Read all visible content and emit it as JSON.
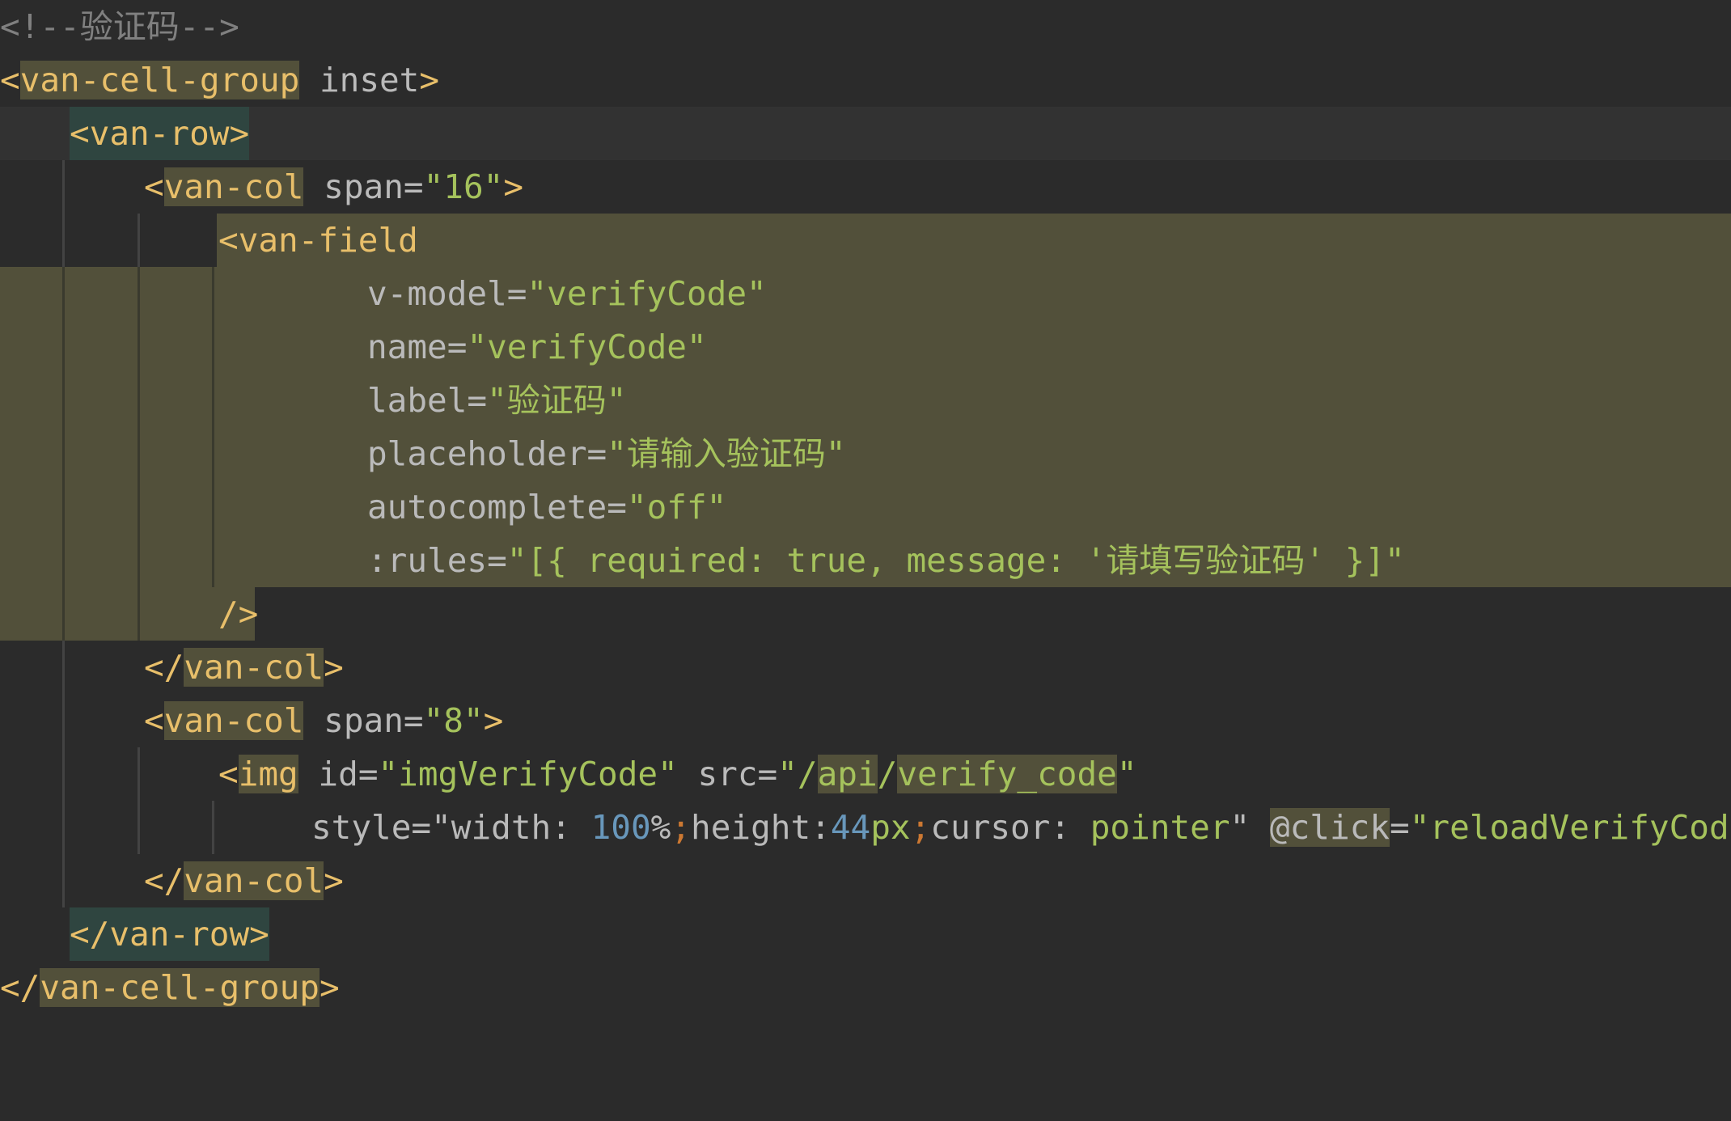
{
  "editor": {
    "theme": "darcula",
    "colors": {
      "background": "#2b2b2b",
      "current_line": "#323232",
      "selection": "#52503a",
      "tag": "#e8bf6a",
      "attr_name": "#bababa",
      "attr_value": "#a5c25c",
      "comment": "#808080",
      "number": "#6897bb",
      "punctuation": "#cc7832"
    },
    "lines": {
      "l1": {
        "comment": "<!--验证码-->"
      },
      "l2": {
        "open": "<",
        "tag": "van-cell-group",
        "attr": " inset",
        "close": ">"
      },
      "l3": {
        "open": "<",
        "tag": "van-row",
        "close": ">"
      },
      "l4": {
        "open": "<",
        "tag": "van-col",
        "attr_name": " span",
        "eq": "=",
        "attr_value": "\"16\"",
        "close": ">"
      },
      "l5": {
        "open": "<",
        "tag": "van-field"
      },
      "l6": {
        "attr_name": "v-model",
        "eq": "=",
        "attr_value": "\"verifyCode\""
      },
      "l7": {
        "attr_name": "name",
        "eq": "=",
        "attr_value": "\"verifyCode\""
      },
      "l8": {
        "attr_name": "label",
        "eq": "=",
        "attr_value": "\"验证码\""
      },
      "l9": {
        "attr_name": "placeholder",
        "eq": "=",
        "attr_value": "\"请输入验证码\""
      },
      "l10": {
        "attr_name": "autocomplete",
        "eq": "=",
        "attr_value": "\"off\""
      },
      "l11": {
        "attr_name": ":rules",
        "eq": "=",
        "attr_value": "\"[{ required: true, message: '请填写验证码' }]\""
      },
      "l12": {
        "close": "/>"
      },
      "l13": {
        "open": "</",
        "tag": "van-col",
        "close": ">"
      },
      "l14": {
        "open": "<",
        "tag": "van-col",
        "attr_name": " span",
        "eq": "=",
        "attr_value": "\"8\"",
        "close": ">"
      },
      "l15": {
        "open": "<",
        "tag": "img",
        "a1_name": " id",
        "eq": "=",
        "a1_value": "\"imgVerifyCode\"",
        "a2_name": " src",
        "a2_value_q1": "\"/",
        "a2_api": "api",
        "a2_slash": "/",
        "a2_path": "verify_code",
        "a2_value_q2": "\""
      },
      "l16": {
        "style_name": "style",
        "eq": "=",
        "q_open": "\"",
        "k1": "width: ",
        "n1": "100",
        "pct": "%",
        "semi1": ";",
        "k2": "height:",
        "n2": "44",
        "unit2": "px",
        "semi2": ";",
        "k3": "cursor: ",
        "v3": "pointer",
        "q_close": "\"",
        "evt": "@click",
        "evt_value": "\"reloadVerifyCode\"",
        "close": ">"
      },
      "l17": {
        "open": "</",
        "tag": "van-col",
        "close": ">"
      },
      "l18": {
        "open": "</",
        "tag": "van-row",
        "close": ">"
      },
      "l19": {
        "open": "</",
        "tag": "van-cell-group",
        "close": ">"
      }
    }
  }
}
